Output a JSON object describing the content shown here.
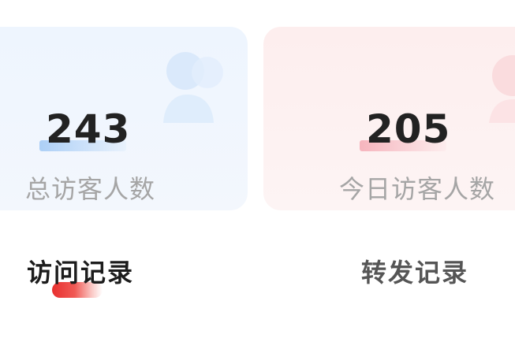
{
  "stats": {
    "total": {
      "value": "243",
      "label": "总访客人数",
      "accent": "#bfd8f5"
    },
    "today": {
      "value": "205",
      "label": "今日访客人数",
      "accent": "#f5c2c8"
    }
  },
  "tabs": [
    {
      "label": "访问记录",
      "active": true
    },
    {
      "label": "转发记录",
      "active": false
    }
  ],
  "colors": {
    "active_indicator": "#e8302f",
    "total_card_bg": "#eef5fe",
    "today_card_bg": "#fdeeee"
  }
}
